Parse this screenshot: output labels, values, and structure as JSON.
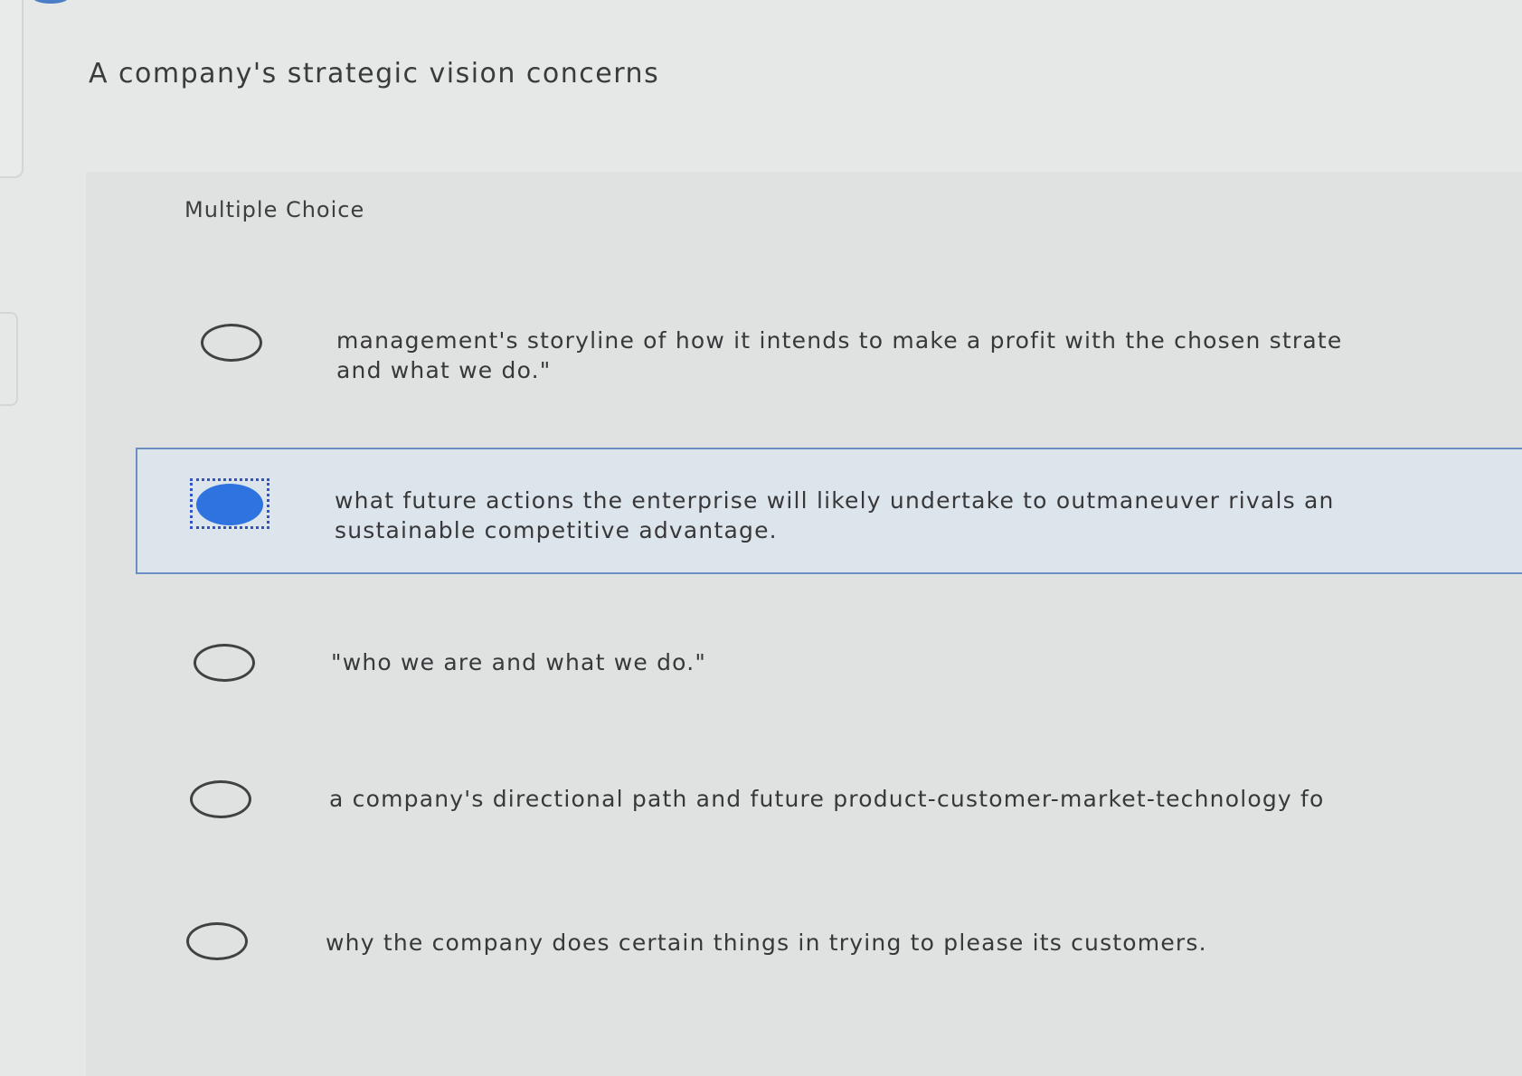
{
  "question": {
    "title": "A company's strategic vision concerns",
    "type_label": "Multiple Choice"
  },
  "choices": [
    {
      "line1": "management's storyline of how it intends to make a profit with the chosen strate",
      "line2": "and what we do.\"",
      "selected": false
    },
    {
      "line1": "what future actions the enterprise will likely undertake to outmaneuver rivals an",
      "line2": "sustainable competitive advantage.",
      "selected": true
    },
    {
      "line1": "\"who we are and what we do.\"",
      "line2": "",
      "selected": false
    },
    {
      "line1": "a company's directional path and future product-customer-market-technology fo",
      "line2": "",
      "selected": false
    },
    {
      "line1": "why the company does certain things in trying to please its customers.",
      "line2": "",
      "selected": false
    }
  ],
  "colors": {
    "background": "#e6e7e7",
    "panel": "#e0e2e2",
    "selected_background": "#dde5ec",
    "selected_border": "#6b8fc2",
    "radio_fill": "#2f73e0",
    "focus_ring": "#3253c8"
  }
}
